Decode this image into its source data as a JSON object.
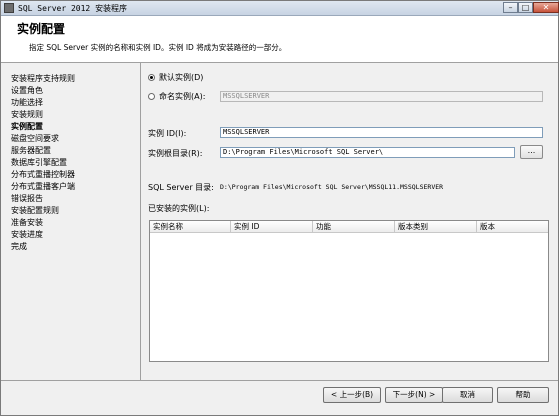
{
  "window": {
    "title": "SQL Server 2012 安装程序",
    "minimize_label": "–",
    "maximize_label": "□",
    "close_label": "✕"
  },
  "header": {
    "title": "实例配置",
    "description": "指定 SQL Server 实例的名称和实例 ID。实例 ID 将成为安装路径的一部分。"
  },
  "sidebar": {
    "items": [
      {
        "label": "安装程序支持规则"
      },
      {
        "label": "设置角色"
      },
      {
        "label": "功能选择"
      },
      {
        "label": "安装规则"
      },
      {
        "label": "实例配置",
        "active": true
      },
      {
        "label": "磁盘空间要求"
      },
      {
        "label": "服务器配置"
      },
      {
        "label": "数据库引擎配置"
      },
      {
        "label": "分布式重播控制器"
      },
      {
        "label": "分布式重播客户端"
      },
      {
        "label": "错误报告"
      },
      {
        "label": "安装配置规则"
      },
      {
        "label": "准备安装"
      },
      {
        "label": "安装进度"
      },
      {
        "label": "完成"
      }
    ]
  },
  "instance": {
    "default_label": "默认实例(D)",
    "named_label": "命名实例(A):",
    "named_value": "MSSQLSERVER",
    "id_label": "实例 ID(I):",
    "id_value": "MSSQLSERVER",
    "root_label": "实例根目录(R):",
    "root_value": "D:\\Program Files\\Microsoft SQL Server\\",
    "browse_label": "...",
    "sqlserver_dir_label": "SQL Server 目录:",
    "sqlserver_dir_value": "D:\\Program Files\\Microsoft SQL Server\\MSSQL11.MSSQLSERVER"
  },
  "installed": {
    "label": "已安装的实例(L):",
    "columns": [
      "实例名称",
      "实例 ID",
      "功能",
      "版本类别",
      "版本"
    ]
  },
  "footer": {
    "back_label": "< 上一步(B)",
    "next_label": "下一步(N) >",
    "cancel_label": "取消",
    "help_label": "帮助"
  }
}
